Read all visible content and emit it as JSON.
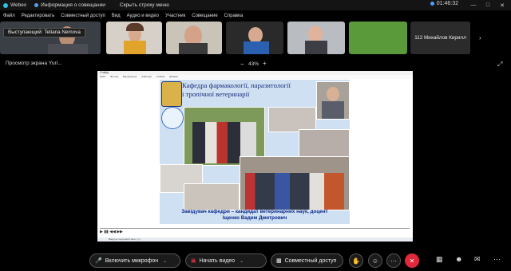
{
  "titlebar": {
    "app_name": "Webex",
    "meeting_info": "Информация о совещании",
    "hide_menu": "Скрыть строку меню",
    "time": "01:46:32"
  },
  "menu": [
    "Файл",
    "Редактировать",
    "Совместный доступ",
    "Вид",
    "Аудио и видео",
    "Участник",
    "Совещание",
    "Справка"
  ],
  "speaker": {
    "prefix": "Выступающий:",
    "name": "Tetiana Nemova"
  },
  "participants": [
    {
      "name": "112 Михайлов Кирилл"
    }
  ],
  "viewbar": {
    "label": "Просмотр экрана Yuri...",
    "zoom_minus": "−",
    "zoom": "43%",
    "zoom_plus": "+"
  },
  "shared": {
    "window_title": "Слайд",
    "menu": [
      "Файл",
      "Вигляд",
      "Відтворення",
      "Навігація",
      "Слайди",
      "Довідка"
    ],
    "slide_title": "Кафедра фармакології, паразитології і тропічної ветеринарії",
    "slide_caption_1": "Завідувач кафедри – кандидат ветеринарних наук, доцент",
    "slide_caption_2": "Іщенко Вадим Дмитрович",
    "taskbar_search": "Введіть пошуковий запит тут"
  },
  "controls": {
    "mic": "Включить микрофон",
    "video": "Начать видео",
    "share": "Совместный доступ"
  },
  "colors": {
    "background": "#000000",
    "end_call": "#e0293a",
    "slide_title": "#1a2d7a",
    "caption": "#0b2a8a"
  }
}
